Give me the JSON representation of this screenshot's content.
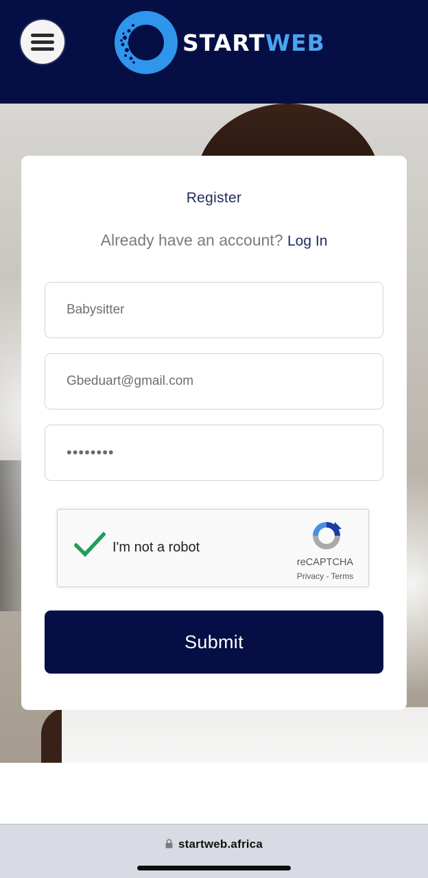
{
  "header": {
    "logo_word1": "START",
    "logo_word2": "WEB"
  },
  "form": {
    "title": "Register",
    "login_prompt": "Already have an account?",
    "login_link": "Log In",
    "fields": [
      {
        "value": "Babysitter"
      },
      {
        "value": "Gbeduart@gmail.com"
      },
      {
        "value": "••••••••"
      }
    ],
    "recaptcha": {
      "label": "I'm not a robot",
      "brand": "reCAPTCHA",
      "links": "Privacy - Terms"
    },
    "submit_label": "Submit"
  },
  "browser": {
    "url": "startweb.africa"
  },
  "colors": {
    "navy": "#050f45",
    "brand_blue": "#4aa3f0",
    "check_green": "#1e9e5a"
  }
}
